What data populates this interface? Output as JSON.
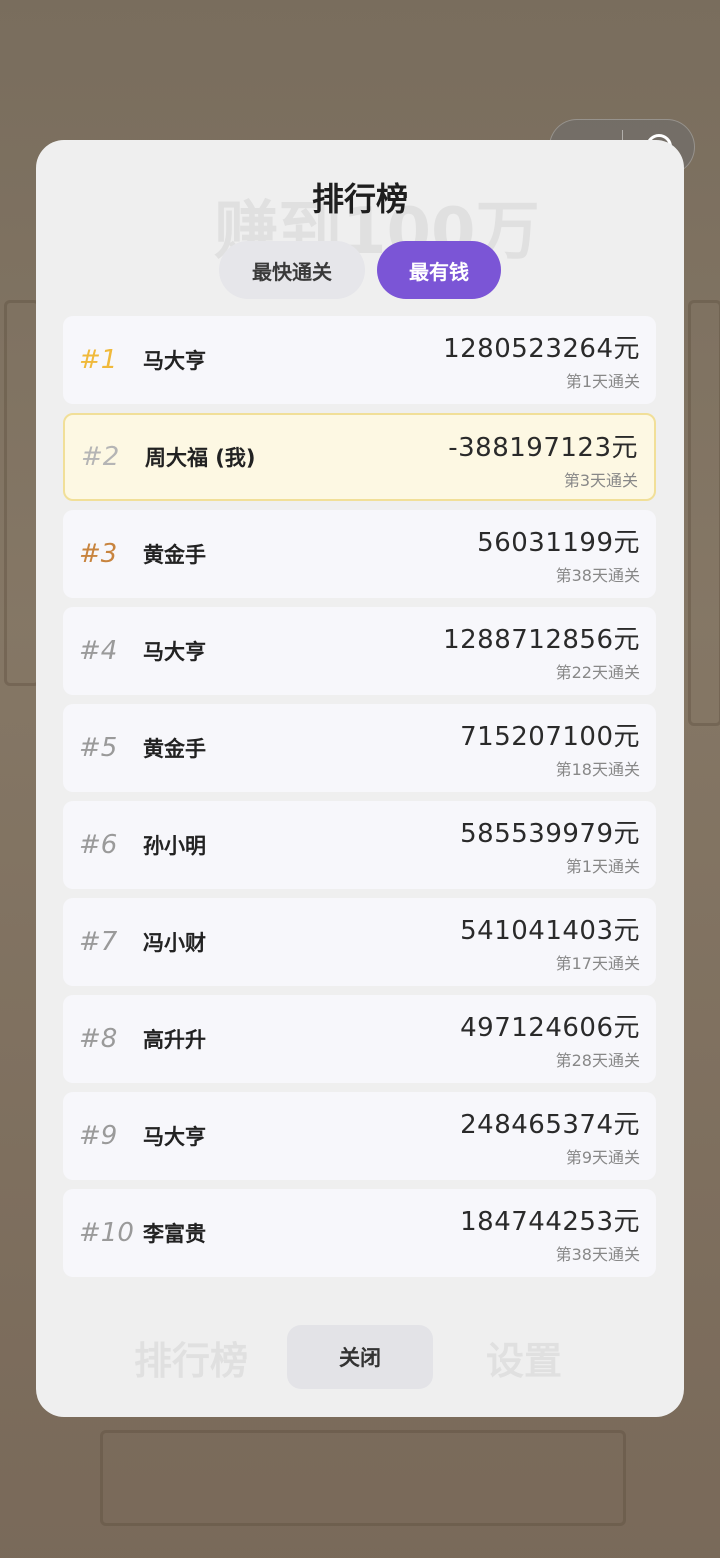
{
  "modal": {
    "title": "排行榜",
    "tabs": [
      {
        "label": "最快通关",
        "active": false
      },
      {
        "label": "最有钱",
        "active": true
      }
    ],
    "close_label": "关闭"
  },
  "background_ghost": {
    "headline": "赚到100万",
    "bottom_left": "排行榜",
    "bottom_right": "设置"
  },
  "leaderboard": [
    {
      "rank": "#1",
      "name": "马大亨",
      "money": "1280523264元",
      "days": "第1天通关",
      "highlight": false
    },
    {
      "rank": "#2",
      "name": "周大福 (我)",
      "money": "-388197123元",
      "days": "第3天通关",
      "highlight": true
    },
    {
      "rank": "#3",
      "name": "黄金手",
      "money": "56031199元",
      "days": "第38天通关",
      "highlight": false
    },
    {
      "rank": "#4",
      "name": "马大亨",
      "money": "1288712856元",
      "days": "第22天通关",
      "highlight": false
    },
    {
      "rank": "#5",
      "name": "黄金手",
      "money": "715207100元",
      "days": "第18天通关",
      "highlight": false
    },
    {
      "rank": "#6",
      "name": "孙小明",
      "money": "585539979元",
      "days": "第1天通关",
      "highlight": false
    },
    {
      "rank": "#7",
      "name": "冯小财",
      "money": "541041403元",
      "days": "第17天通关",
      "highlight": false
    },
    {
      "rank": "#8",
      "name": "高升升",
      "money": "497124606元",
      "days": "第28天通关",
      "highlight": false
    },
    {
      "rank": "#9",
      "name": "马大亨",
      "money": "248465374元",
      "days": "第9天通关",
      "highlight": false
    },
    {
      "rank": "#10",
      "name": "李富贵",
      "money": "184744253元",
      "days": "第38天通关",
      "highlight": false
    }
  ],
  "colors": {
    "accent": "#7b55d6",
    "gold": "#f0b93a",
    "silver": "#b5b5b5",
    "bronze": "#c8843e",
    "highlight_bg": "#fdf8e3"
  }
}
